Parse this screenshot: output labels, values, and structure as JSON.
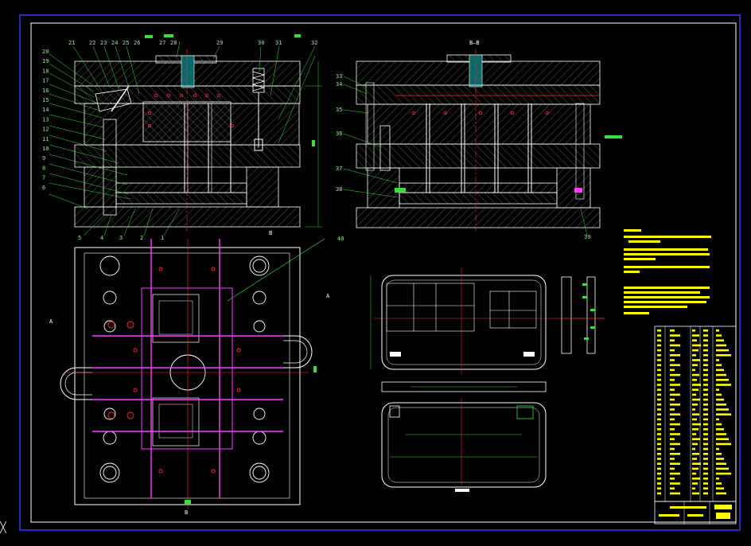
{
  "drawing": {
    "colors": {
      "background": "#000000",
      "frame_border": "#3c3cff",
      "outline": "#ffffff",
      "hatch": "#7a7a7a",
      "leader": "#3ddc3d",
      "cooling": "#ff3cff",
      "red_center": "#ff3030",
      "note_yellow": "#ffff00",
      "title_fill": "#ffff00"
    },
    "front_view": {
      "top_labels": [
        "21",
        "22",
        "23",
        "24",
        "25",
        "26",
        "27",
        "28",
        "29",
        "30",
        "31",
        "32"
      ],
      "left_labels": [
        "20",
        "19",
        "18",
        "17",
        "16",
        "15",
        "14",
        "13",
        "12",
        "11",
        "10",
        "9",
        "8",
        "7",
        "6"
      ],
      "bottom_labels": [
        "5",
        "4",
        "3",
        "2",
        "1"
      ]
    },
    "side_view": {
      "section_label": "B—B",
      "left_labels": [
        "33",
        "34",
        "35",
        "36",
        "37",
        "38"
      ],
      "right_label": "39"
    },
    "plan_view": {
      "callout": "40",
      "cut_labels": [
        "B",
        "A",
        "A",
        "B"
      ]
    }
  }
}
